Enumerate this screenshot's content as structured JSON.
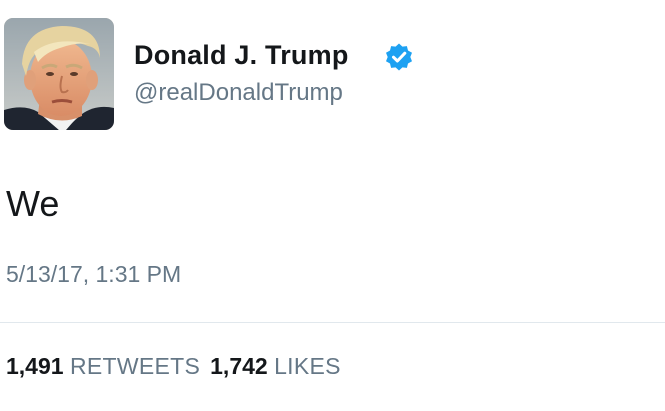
{
  "author": {
    "display_name": "Donald J. Trump",
    "handle": "@realDonaldTrump",
    "verified": true,
    "avatar_icon": "profile-photo",
    "verified_icon": "verified-badge-icon"
  },
  "tweet": {
    "text": "We",
    "timestamp": "5/13/17, 1:31 PM"
  },
  "stats": {
    "retweets_count": "1,491",
    "retweets_label": "RETWEETS",
    "likes_count": "1,742",
    "likes_label": "LIKES"
  },
  "colors": {
    "verified_blue": "#1da1f2",
    "secondary_text": "#657786",
    "primary_text": "#14171a",
    "divider": "#e1e8ed"
  }
}
